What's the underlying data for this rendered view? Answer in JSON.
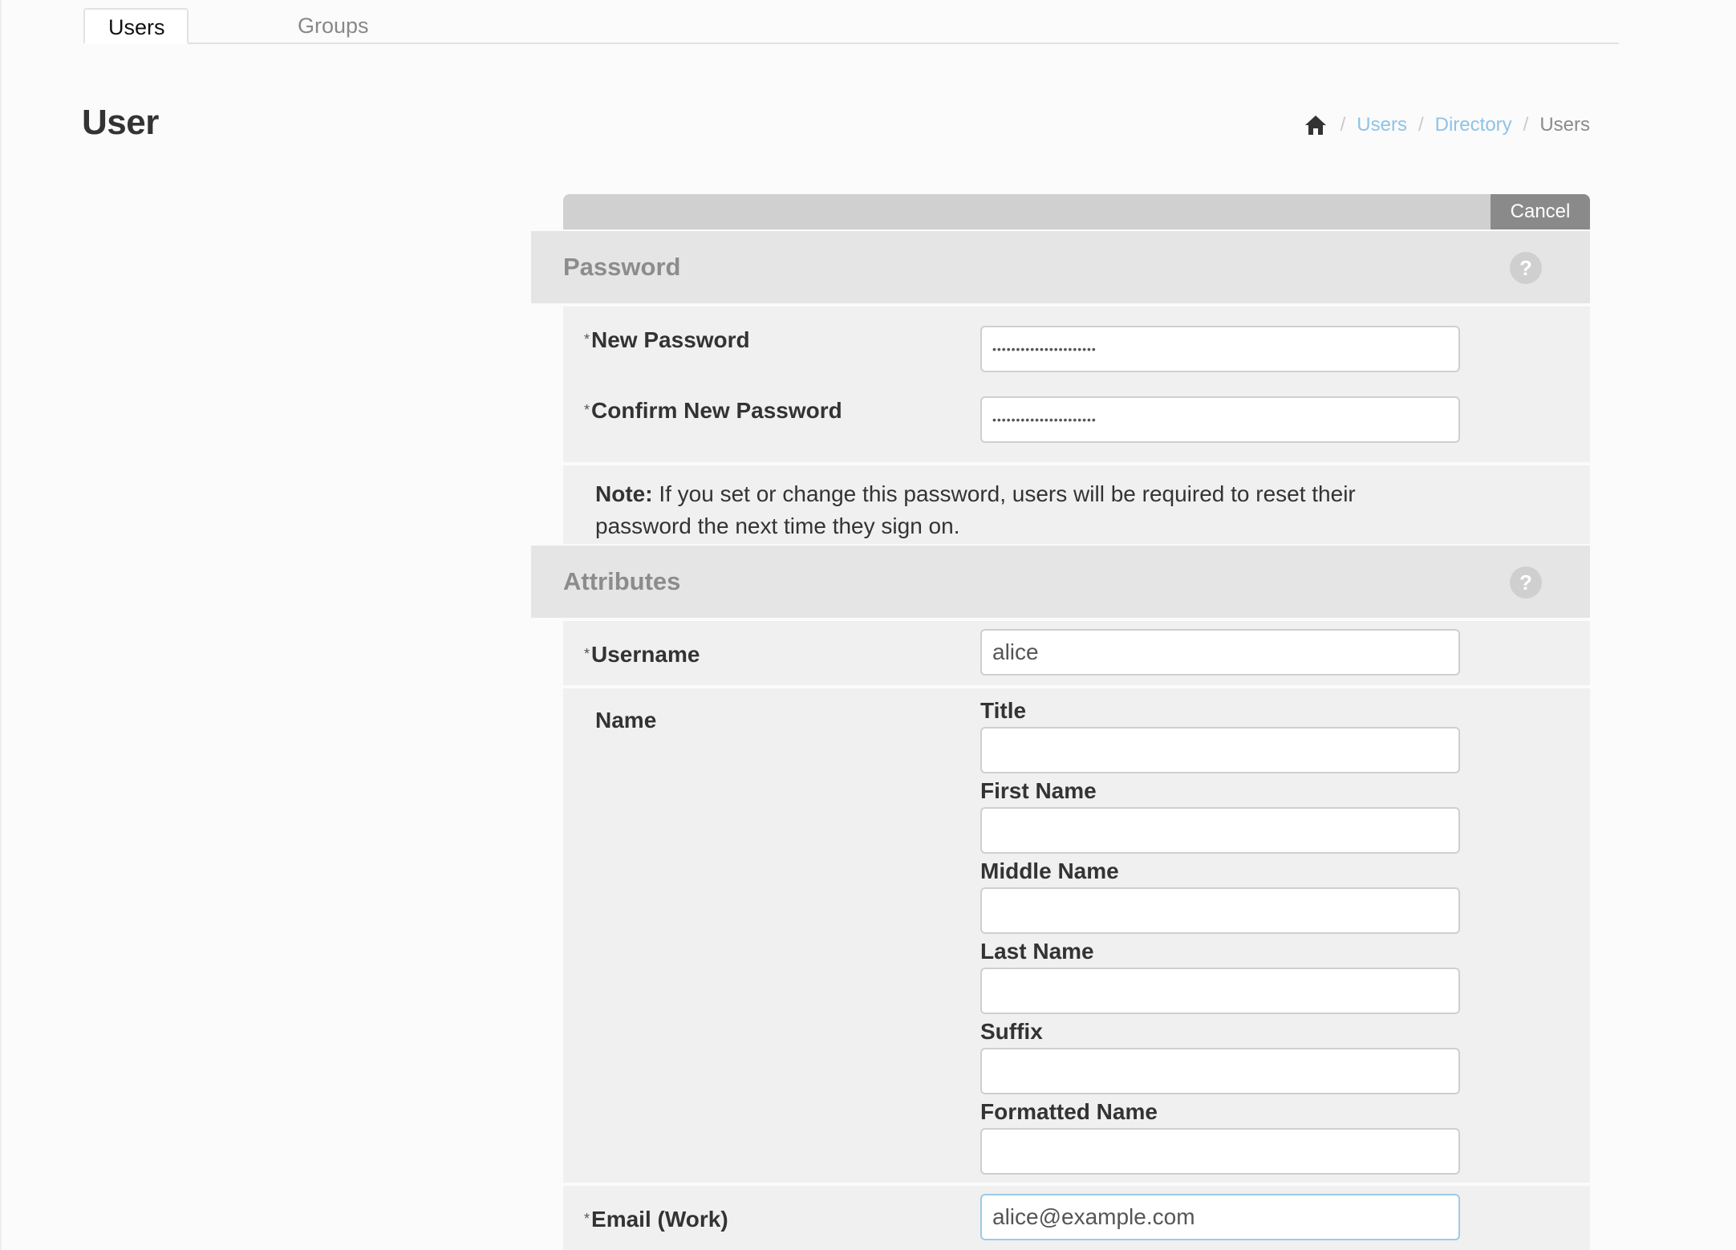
{
  "tabs": [
    {
      "label": "Users",
      "active": true
    },
    {
      "label": "Groups",
      "active": false
    }
  ],
  "page": {
    "title": "User"
  },
  "breadcrumb": {
    "home_icon": "home-icon",
    "separator": "/",
    "items": [
      {
        "label": "Users",
        "link": true
      },
      {
        "label": "Directory",
        "link": true
      },
      {
        "label": "Users",
        "link": false
      }
    ]
  },
  "toolbar": {
    "cancel_label": "Cancel"
  },
  "password_section": {
    "title": "Password",
    "help_icon": "?",
    "fields": [
      {
        "label": "New Password",
        "required": "*",
        "value": "••••••••••••••••••••••"
      },
      {
        "label": "Confirm New Password",
        "required": "*",
        "value": "••••••••••••••••••••••"
      }
    ],
    "note_label": "Note:",
    "note_text": " If you set or change this password, users will be required to reset their password the next time they sign on."
  },
  "attributes_section": {
    "title": "Attributes",
    "help_icon": "?",
    "username": {
      "label": "Username",
      "required": "*",
      "value": "alice"
    },
    "name": {
      "label": "Name",
      "subfields": [
        {
          "label": "Title",
          "value": ""
        },
        {
          "label": "First Name",
          "value": ""
        },
        {
          "label": "Middle Name",
          "value": ""
        },
        {
          "label": "Last Name",
          "value": ""
        },
        {
          "label": "Suffix",
          "value": ""
        },
        {
          "label": "Formatted Name",
          "value": ""
        }
      ]
    },
    "email": {
      "label": "Email (Work)",
      "required": "*",
      "value": "alice@example.com"
    }
  },
  "colors": {
    "link": "#8ec3e6",
    "focus_border": "#9ccbe8",
    "section_header_bg": "#e5e5e5",
    "row_bg": "#f0f0f0",
    "cancel_bg": "#8a8a8a"
  }
}
